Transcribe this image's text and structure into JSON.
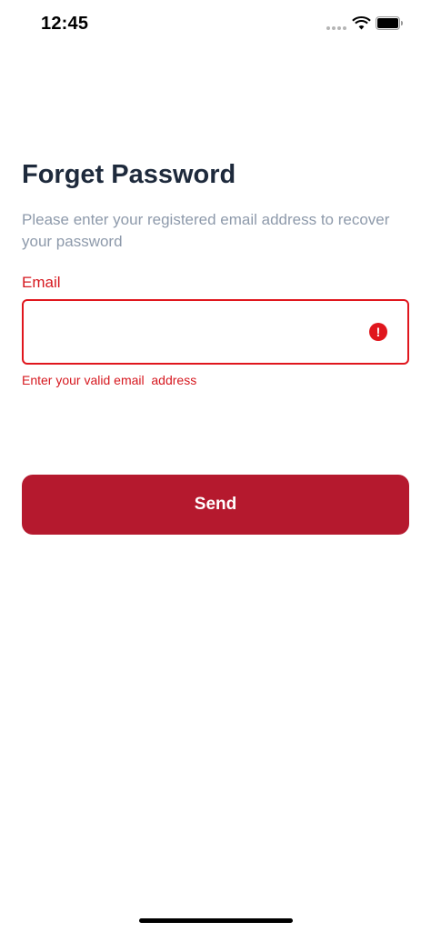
{
  "status_bar": {
    "time": "12:45",
    "icons": [
      "signal-dots-icon",
      "wifi-icon",
      "battery-icon"
    ]
  },
  "form": {
    "title": "Forget Password",
    "subtitle": "Please enter your registered email address to recover your password",
    "email": {
      "label": "Email",
      "value": "",
      "placeholder": "",
      "error_icon": "exclamation-circle-icon",
      "error_message": "Enter your valid email  address"
    },
    "send_label": "Send"
  },
  "colors": {
    "title": "#1e2a3c",
    "subtitle": "#8e9aab",
    "error": "#e0161d",
    "primary_button": "#b5192e",
    "background": "#ffffff"
  }
}
